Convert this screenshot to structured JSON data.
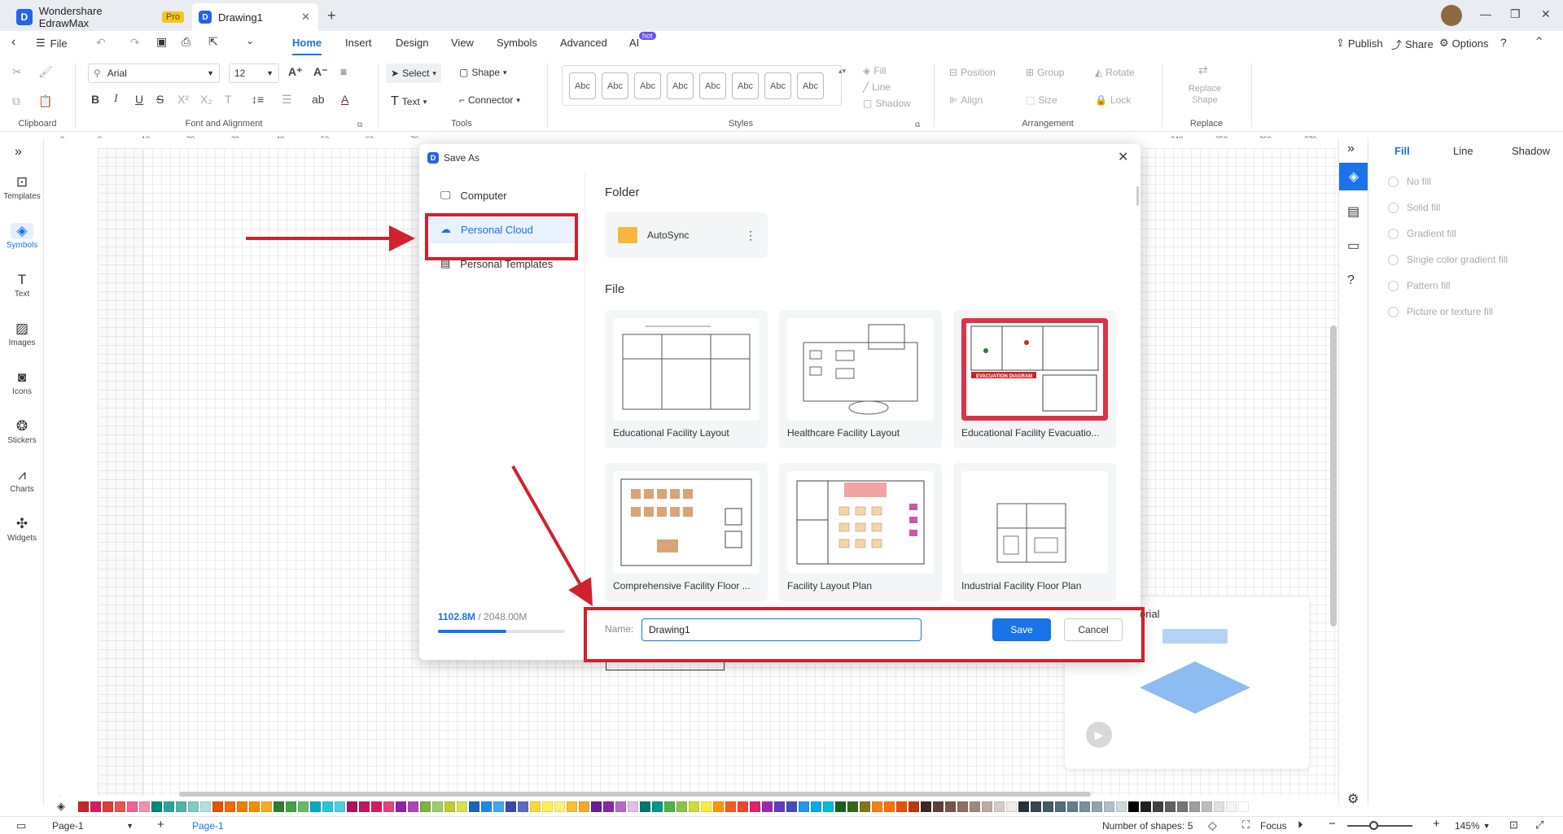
{
  "titlebar": {
    "app_name": "Wondershare EdrawMax",
    "pro_badge": "Pro",
    "doc_tab": "Drawing1",
    "new_tab": "+",
    "controls": [
      "—",
      "❐",
      "✕"
    ]
  },
  "menu": {
    "file": "File",
    "items": [
      "Home",
      "Insert",
      "Design",
      "View",
      "Symbols",
      "Advanced",
      "AI"
    ],
    "hot_badge": "hot",
    "right": {
      "publish": "Publish",
      "share": "Share",
      "options": "Options"
    }
  },
  "ribbon": {
    "groups": [
      "Clipboard",
      "Font and Alignment",
      "Tools",
      "Styles",
      "Arrangement",
      "Replace"
    ],
    "font_family": "Arial",
    "font_size": "12",
    "select": "Select",
    "shape": "Shape",
    "text": "Text",
    "connector": "Connector",
    "style_swatch": "Abc",
    "fill": "Fill",
    "line": "Line",
    "shadow": "Shadow",
    "position": "Position",
    "group": "Group",
    "rotate": "Rotate",
    "align": "Align",
    "size": "Size",
    "lock": "Lock",
    "replace_shape_1": "Replace",
    "replace_shape_2": "Shape"
  },
  "sidebar": {
    "items": [
      {
        "label": "Templates",
        "icon": "templates-icon"
      },
      {
        "label": "Symbols",
        "icon": "symbols-icon"
      },
      {
        "label": "Text",
        "icon": "text-icon"
      },
      {
        "label": "Images",
        "icon": "images-icon"
      },
      {
        "label": "Icons",
        "icon": "icons-icon"
      },
      {
        "label": "Stickers",
        "icon": "stickers-icon"
      },
      {
        "label": "Charts",
        "icon": "charts-icon"
      },
      {
        "label": "Widgets",
        "icon": "widgets-icon"
      }
    ]
  },
  "ruler": {
    "h": [
      "0",
      "0",
      "10",
      "20",
      "30",
      "40",
      "50",
      "60",
      "70",
      "240",
      "250",
      "260",
      "270"
    ],
    "v": [
      "50",
      "60",
      "70",
      "80",
      "90",
      "100",
      "110",
      "120",
      "130",
      "140",
      "150",
      "160",
      "170",
      "180"
    ]
  },
  "right_panel": {
    "tabs": [
      "Fill",
      "Line",
      "Shadow"
    ],
    "fill_options": [
      "No fill",
      "Solid fill",
      "Gradient fill",
      "Single color gradient fill",
      "Pattern fill",
      "Picture or texture fill"
    ]
  },
  "dialog": {
    "title": "Save As",
    "nav": [
      "Computer",
      "Personal Cloud",
      "Personal Templates"
    ],
    "storage_used": "1102.8M",
    "storage_total": " / 2048.00M",
    "storage_fraction": 0.54,
    "folder_heading": "Folder",
    "folder_name": "AutoSync",
    "file_heading": "File",
    "files": [
      "Educational Facility Layout",
      "Healthcare Facility Layout",
      "Educational Facility Evacuatio...",
      "Comprehensive Facility Floor ...",
      "Facility Layout Plan",
      "Industrial Facility Floor Plan"
    ],
    "evac_banner": "EVACUATION DIAGRAM",
    "name_label": "Name:",
    "name_value": "Drawing1",
    "save": "Save",
    "cancel": "Cancel"
  },
  "tutorial_peek": "orial",
  "statusbar": {
    "page_selector": "Page-1",
    "page_tab": "Page-1",
    "shapes": "Number of shapes: 5",
    "focus": "Focus",
    "zoom": "145%"
  },
  "colors": {
    "accent": "#1a73e8",
    "highlight": "#d3202e",
    "palette": [
      "#c62828",
      "#d81b60",
      "#e53935",
      "#ef5350",
      "#f06292",
      "#f48fb1",
      "#00897b",
      "#26a69a",
      "#4db6ac",
      "#80cbc4",
      "#b2dfdb",
      "#e65100",
      "#ef6c00",
      "#f57c00",
      "#fb8c00",
      "#ffa726",
      "#2e7d32",
      "#43a047",
      "#66bb6a",
      "#00acc1",
      "#26c6da",
      "#4dd0e1",
      "#ad1457",
      "#c2185b",
      "#d81b60",
      "#ec407a",
      "#8e24aa",
      "#ab47bc",
      "#7cb342",
      "#9ccc65",
      "#c0ca33",
      "#d4e157",
      "#1565c0",
      "#1e88e5",
      "#42a5f5",
      "#3949ab",
      "#5c6bc0",
      "#fdd835",
      "#ffee58",
      "#fff176",
      "#fbc02d",
      "#f9a825",
      "#6a1b9a",
      "#8e24aa",
      "#ba68c8",
      "#e1bee7",
      "#00796b",
      "#009688",
      "#4caf50",
      "#8bc34a",
      "#cddc39",
      "#ffeb3b",
      "#ff9800",
      "#ff5722",
      "#f44336",
      "#e91e63",
      "#9c27b0",
      "#673ab7",
      "#3f51b5",
      "#2196f3",
      "#03a9f4",
      "#00bcd4",
      "#1b5e20",
      "#33691e",
      "#827717",
      "#f57f17",
      "#ff6f00",
      "#e65100",
      "#bf360c",
      "#3e2723",
      "#5d4037",
      "#795548",
      "#8d6e63",
      "#a1887f",
      "#bcaaa4",
      "#d7ccc8",
      "#efebe9",
      "#263238",
      "#37474f",
      "#455a64",
      "#546e7a",
      "#607d8b",
      "#78909c",
      "#90a4ae",
      "#b0bec5",
      "#cfd8dc",
      "#000000",
      "#212121",
      "#424242",
      "#616161",
      "#757575",
      "#9e9e9e",
      "#bdbdbd",
      "#e0e0e0",
      "#f5f5f5",
      "#ffffff"
    ]
  }
}
